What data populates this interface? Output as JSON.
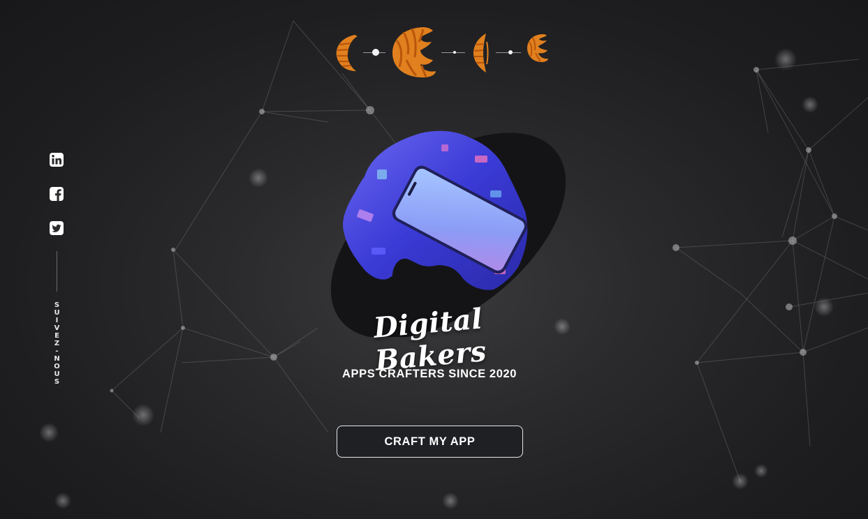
{
  "social": {
    "items": [
      {
        "name": "linkedin",
        "icon": "linkedin-icon"
      },
      {
        "name": "facebook",
        "icon": "facebook-icon"
      },
      {
        "name": "twitter",
        "icon": "twitter-icon"
      }
    ],
    "follow_label": "SUIVEZ-NOUS"
  },
  "nav_steps": {
    "icon": "croissant-icon",
    "count": 4,
    "active_step": 2
  },
  "hero": {
    "title": "Digital Bakers",
    "tagline": "APPS CRAFTERS SINCE 2020",
    "cta_label": "CRAFT MY APP",
    "image": "smartphone-illustration"
  },
  "colors": {
    "background": "#1e1e20",
    "croissant": "#e0801e",
    "croissant_stripe": "#b8550c",
    "button_border": "#e6e6e6",
    "text": "#ffffff"
  }
}
